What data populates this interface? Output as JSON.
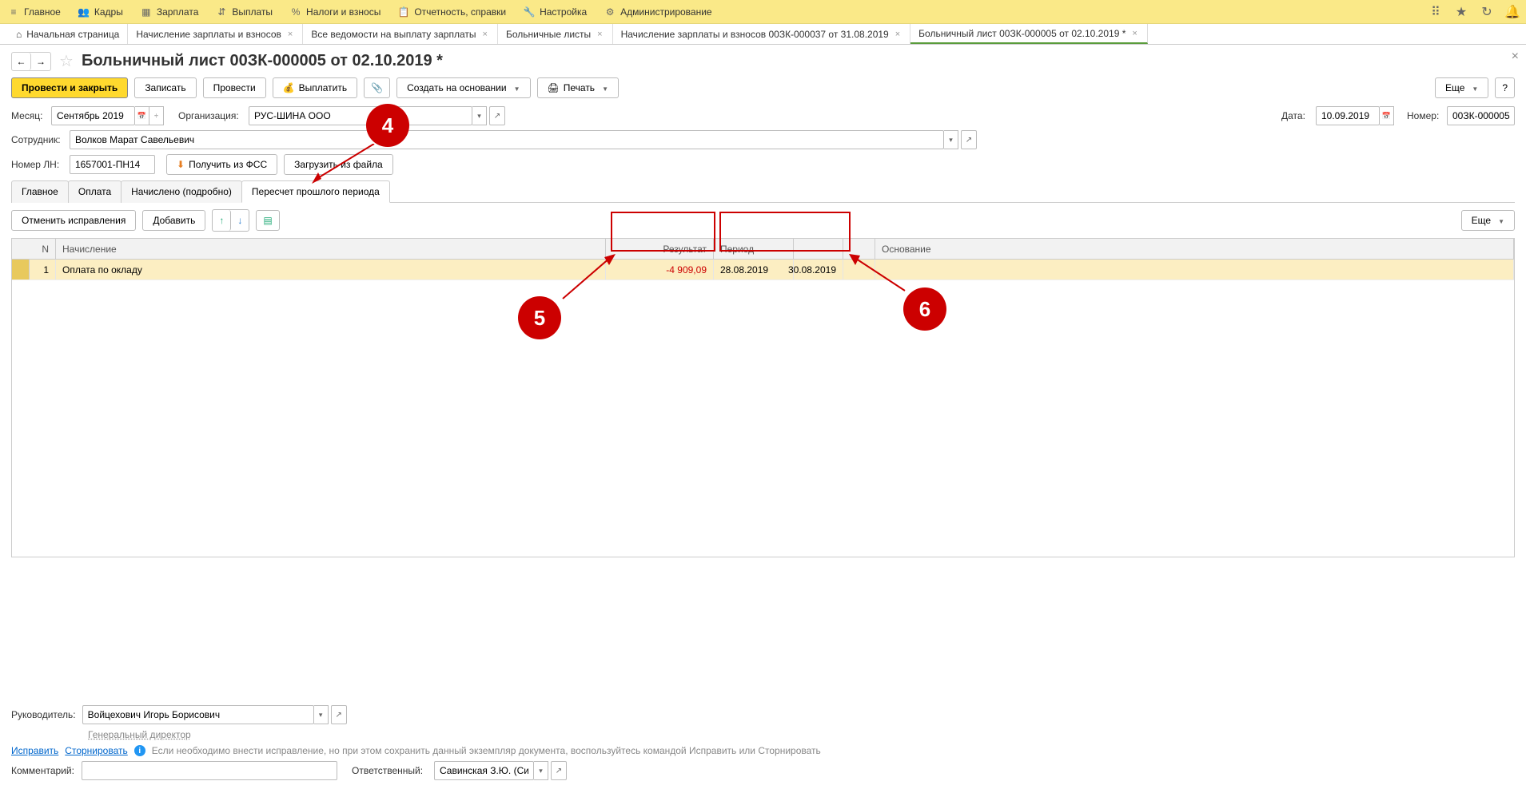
{
  "topmenu": {
    "main": "Главное",
    "hr": "Кадры",
    "salary": "Зарплата",
    "payments": "Выплаты",
    "taxes": "Налоги и взносы",
    "reports": "Отчетность, справки",
    "settings": "Настройка",
    "admin": "Администрирование"
  },
  "tabs": {
    "home": "Начальная страница",
    "t1": "Начисление зарплаты и взносов",
    "t2": "Все ведомости на выплату зарплаты",
    "t3": "Больничные листы",
    "t4": "Начисление зарплаты и взносов 00ЗК-000037 от 31.08.2019",
    "t5": "Больничный лист 00ЗК-000005 от 02.10.2019 *"
  },
  "title": "Больничный лист 00ЗК-000005 от 02.10.2019 *",
  "toolbar": {
    "post_close": "Провести и закрыть",
    "save": "Записать",
    "post": "Провести",
    "pay": "Выплатить",
    "create_based": "Создать на основании",
    "print": "Печать",
    "more": "Еще"
  },
  "form": {
    "month_label": "Месяц:",
    "month_value": "Сентябрь 2019",
    "org_label": "Организация:",
    "org_value": "РУС-ШИНА ООО",
    "date_label": "Дата:",
    "date_value": "10.09.2019",
    "number_label": "Номер:",
    "number_value": "00ЗК-000005",
    "employee_label": "Сотрудник:",
    "employee_value": "Волков Марат Савельевич",
    "ln_label": "Номер ЛН:",
    "ln_value": "1657001-ПН14",
    "get_fss": "Получить из ФСС",
    "load_file": "Загрузить из файла"
  },
  "subtabs": {
    "main": "Главное",
    "payment": "Оплата",
    "accrued": "Начислено (подробно)",
    "recalc": "Пересчет прошлого периода"
  },
  "tabtoolbar": {
    "cancel": "Отменить исправления",
    "add": "Добавить",
    "more": "Еще"
  },
  "grid": {
    "headers": {
      "n": "N",
      "accrual": "Начисление",
      "result": "Результат",
      "period": "Период",
      "base": "Основание"
    },
    "row": {
      "n": "1",
      "accrual": "Оплата по окладу",
      "result": "-4 909,09",
      "period_from": "28.08.2019",
      "period_to": "30.08.2019"
    }
  },
  "footer": {
    "manager_label": "Руководитель:",
    "manager_value": "Войцехович Игорь Борисович",
    "manager_title": "Генеральный директор",
    "fix": "Исправить",
    "storno": "Сторнировать",
    "hint": "Если необходимо внести исправление, но при этом сохранить данный экземпляр документа, воспользуйтесь командой Исправить или Сторнировать",
    "comment_label": "Комментарий:",
    "responsible_label": "Ответственный:",
    "responsible_value": "Савинская З.Ю. (Системн"
  },
  "callouts": {
    "c4": "4",
    "c5": "5",
    "c6": "6"
  }
}
